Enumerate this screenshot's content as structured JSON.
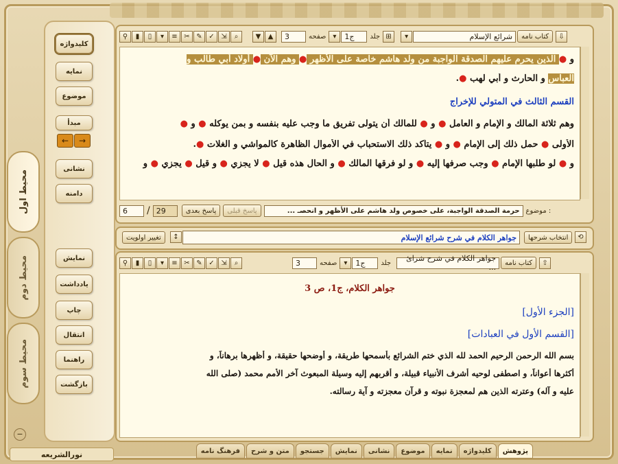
{
  "app": {
    "title": "نورالشریعه"
  },
  "left_tabs": [
    {
      "label": "محیط اول",
      "active": true
    },
    {
      "label": "محیط دوم",
      "active": false
    },
    {
      "label": "محیط سوم",
      "active": false
    }
  ],
  "sidebar": {
    "top_buttons": [
      "کلیدواژه",
      "نمایه",
      "موضوع",
      "مبدأ"
    ],
    "mid_buttons": [
      "نشانی",
      "دامنه"
    ],
    "bottom_buttons": [
      "نمایش",
      "یادداشت",
      "چاپ",
      "انتقال",
      "راهنما",
      "بازگشت"
    ],
    "arrow_left": "←",
    "arrow_right": "→"
  },
  "toolbar_icons": [
    "?",
    "⇲",
    "✓",
    "✎",
    "✂",
    "☰",
    "≡",
    "▾",
    "▮",
    "▯",
    "👓"
  ],
  "top_panel": {
    "book_button": "کتاب نامه",
    "book_name": "شرائع الإسلام",
    "volume_label": "جلد",
    "volume_value": "ج1",
    "page_label": "صفحه",
    "page_value": "3",
    "text_lines": [
      {
        "segments": [
          {
            "t": "و ",
            "s": "n"
          },
          {
            "t": "●",
            "s": "dot"
          },
          {
            "t": " الذين يحرم عليهم الصدقة الواجبة من ولد هاشم خاصة على الأظهر ",
            "s": "hl"
          },
          {
            "t": "●",
            "s": "dot"
          },
          {
            "t": " وهم الآن ",
            "s": "hl"
          },
          {
            "t": "●",
            "s": "dot"
          },
          {
            "t": " أولاد أبي طالب و",
            "s": "hl"
          }
        ]
      },
      {
        "segments": [
          {
            "t": "العباس",
            "s": "hl"
          },
          {
            "t": " و الحارث و أبي لهب ",
            "s": "n"
          },
          {
            "t": "●",
            "s": "dot"
          },
          {
            "t": ".",
            "s": "n"
          }
        ]
      },
      {
        "segments": [
          {
            "t": "القسم الثالث في المتولي للإخراج",
            "s": "head"
          }
        ]
      },
      {
        "segments": [
          {
            "t": "وهم ثلاثة المالك و الإمام و العامل ",
            "s": "n"
          },
          {
            "t": "●",
            "s": "dot"
          },
          {
            "t": " و ",
            "s": "n"
          },
          {
            "t": "●",
            "s": "dot"
          },
          {
            "t": " للمالك أن يتولى تفريق ما وجب عليه بنفسه و بمن يوكله ",
            "s": "n"
          },
          {
            "t": "●",
            "s": "dot"
          },
          {
            "t": " و ",
            "s": "n"
          },
          {
            "t": "●",
            "s": "dot"
          }
        ]
      },
      {
        "segments": [
          {
            "t": "الأولى ",
            "s": "n"
          },
          {
            "t": "●",
            "s": "dot"
          },
          {
            "t": " حمل ذلك إلى الإمام ",
            "s": "n"
          },
          {
            "t": "●",
            "s": "dot"
          },
          {
            "t": " و ",
            "s": "n"
          },
          {
            "t": "●",
            "s": "dot"
          },
          {
            "t": " يتأكد ذلك الاستحباب في الأموال الظاهرة كالمواشي و الغلات ",
            "s": "n"
          },
          {
            "t": "●",
            "s": "dot"
          },
          {
            "t": ".",
            "s": "n"
          }
        ]
      },
      {
        "segments": [
          {
            "t": "و ",
            "s": "n"
          },
          {
            "t": "●",
            "s": "dot"
          },
          {
            "t": " لو طلبها الإمام ",
            "s": "n"
          },
          {
            "t": "●",
            "s": "dot"
          },
          {
            "t": " وجب صرفها إليه ",
            "s": "n"
          },
          {
            "t": "●",
            "s": "dot"
          },
          {
            "t": " و لو فرقها المالك ",
            "s": "n"
          },
          {
            "t": "●",
            "s": "dot"
          },
          {
            "t": " و الحال هذه قيل ",
            "s": "n"
          },
          {
            "t": "●",
            "s": "dot"
          },
          {
            "t": " لا يجزي ",
            "s": "n"
          },
          {
            "t": "●",
            "s": "dot"
          },
          {
            "t": " و قيل ",
            "s": "n"
          },
          {
            "t": "●",
            "s": "dot"
          },
          {
            "t": " يجزي ",
            "s": "n"
          },
          {
            "t": "●",
            "s": "dot"
          },
          {
            "t": " و",
            "s": "n"
          }
        ]
      }
    ],
    "topic_label": "موضوع :",
    "topic_value": "حرمة الصدقة الواجبة، على خصوص ولد هاشم على الأظهر و انحصـ ...",
    "prev_answer": "پاسخ قبلی",
    "next_answer": "پاسخ بعدی",
    "counter_value": "29",
    "counter_sep": "/",
    "counter_total": "6"
  },
  "middle_bar": {
    "select_commentary": "انتخاب شرحها",
    "commentary_name": "جواهر الكلام في شرح شرائع الإسلام",
    "change_priority": "تغییر اولویت"
  },
  "bottom_panel": {
    "book_button": "کتاب نامه",
    "book_name": "جواهر الكلام في شرح شرائ ...",
    "volume_label": "جلد",
    "volume_value": "ج1",
    "page_label": "صفحه",
    "page_value": "3",
    "title": "جواهر الكلام، ج1، ص 3",
    "section1": "[الجزء الأول]",
    "section2": "[القسم الأول في العبادات]",
    "paragraph": [
      "بسم الله الرحمن الرحيم الحمد لله الذي ختم الشرائع بأسمحها طريقة، و أوضحها حقيقة، و أظهرها برهاناً، و",
      "أكثرها أعواناً، و اصطفى لوحيه أشرف الأنبياء قبيلة، و أقربهم إليه وسيلة المبعوث آخر الأمم محمد (صلى الله",
      "عليه و آله) وعترته الذين هم لمعجزة نبوته و قرآن معجزته و آية رسالته."
    ]
  },
  "bottom_tabs": [
    "پژوهش",
    "کلیدواژه",
    "نمایه",
    "موضوع",
    "نشانی",
    "نمایش",
    "جستجو",
    "متن و شرح",
    "فرهنگ نامه"
  ],
  "colors": {
    "highlight": "#b58f3e",
    "heading": "#1c3fbf",
    "marker": "#d8241c",
    "title": "#8b1a10"
  }
}
